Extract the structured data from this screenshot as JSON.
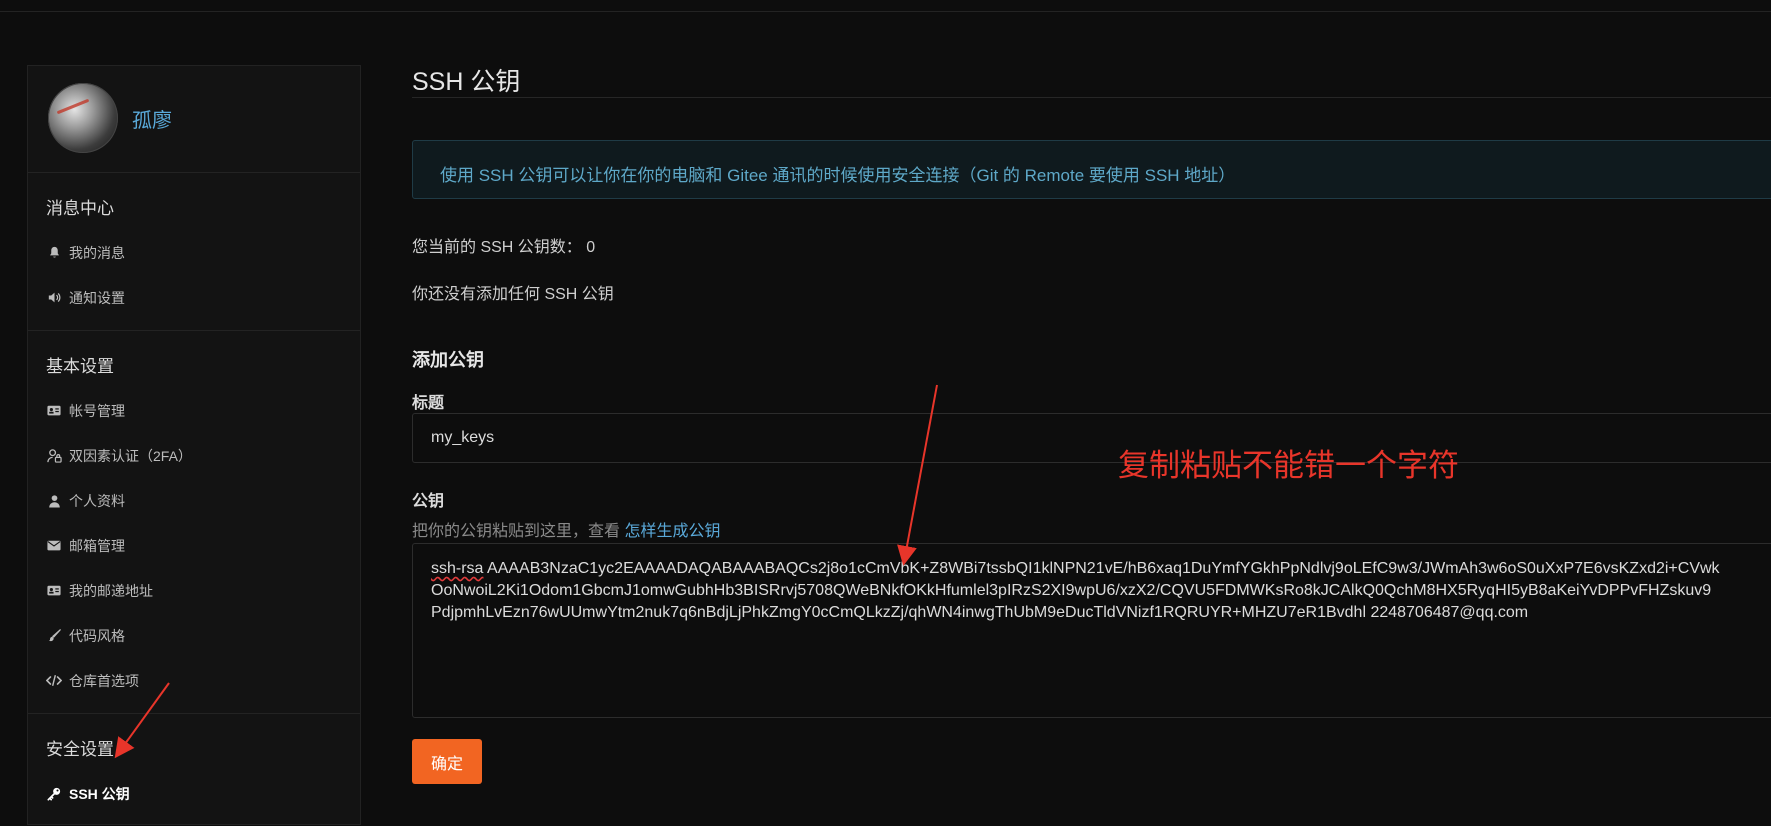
{
  "user": {
    "name": "孤廖"
  },
  "sidebar": {
    "groups": [
      {
        "title": "消息中心",
        "items": [
          {
            "label": "我的消息",
            "icon": "bell-icon"
          },
          {
            "label": "通知设置",
            "icon": "speaker-icon"
          }
        ]
      },
      {
        "title": "基本设置",
        "items": [
          {
            "label": "帐号管理",
            "icon": "id-card-icon"
          },
          {
            "label": "双因素认证（2FA）",
            "icon": "user-lock-icon"
          },
          {
            "label": "个人资料",
            "icon": "user-icon"
          },
          {
            "label": "邮箱管理",
            "icon": "envelope-icon"
          },
          {
            "label": "我的邮递地址",
            "icon": "address-card-icon"
          },
          {
            "label": "代码风格",
            "icon": "brush-icon"
          },
          {
            "label": "仓库首选项",
            "icon": "code-icon"
          }
        ]
      },
      {
        "title": "安全设置",
        "items": [
          {
            "label": "SSH 公钥",
            "icon": "key-icon",
            "active": true
          }
        ]
      }
    ]
  },
  "main": {
    "title": "SSH 公钥",
    "info": "使用 SSH 公钥可以让你在你的电脑和 Gitee 通讯的时候使用安全连接（Git 的 Remote 要使用 SSH 地址）",
    "count_text": "您当前的 SSH 公钥数：  0",
    "none_text": "你还没有添加任何 SSH 公钥",
    "add_heading": "添加公钥",
    "title_label": "标题",
    "title_value": "my_keys",
    "key_label": "公钥",
    "hint_text": "把你的公钥粘贴到这里，查看 ",
    "hint_link": "怎样生成公钥",
    "key_prefix": "ssh-rsa",
    "key_line1": " AAAAB3NzaC1yc2EAAAADAQABAAABAQCs2j8o1cCmVbK+Z8WBi7tssbQI1klNPN21vE/hB6xaq1DuYmfYGkhPpNdlvj9oLEfC9w3/JWmAh3w6oS0uXxP7E6vsKZxd2i+CVwk",
    "key_line2": "OoNwoiL2Ki1Odom1GbcmJ1omwGubhHb3BISRrvj5708QWeBNkfOKkHfumlel3pIRzS2XI9wpU6/xzX2/CQVU5FDMWKsRo8kJCAlkQ0QchM8HX5RyqHI5yB8aKeiYvDPPvFHZskuv9",
    "key_line3": "PdjpmhLvEzn76wUUmwYtm2nuk7q6nBdjLjPhkZmgY0cCmQLkzZj/qhWN4inwgThUbM9eDucTldVNizf1RQRUYR+MHZU7eR1Bvdhl 2248706487@qq.com",
    "confirm": "确定"
  },
  "annotation": {
    "text": "复制粘贴不能错一个字符",
    "color": "#e8352a"
  }
}
